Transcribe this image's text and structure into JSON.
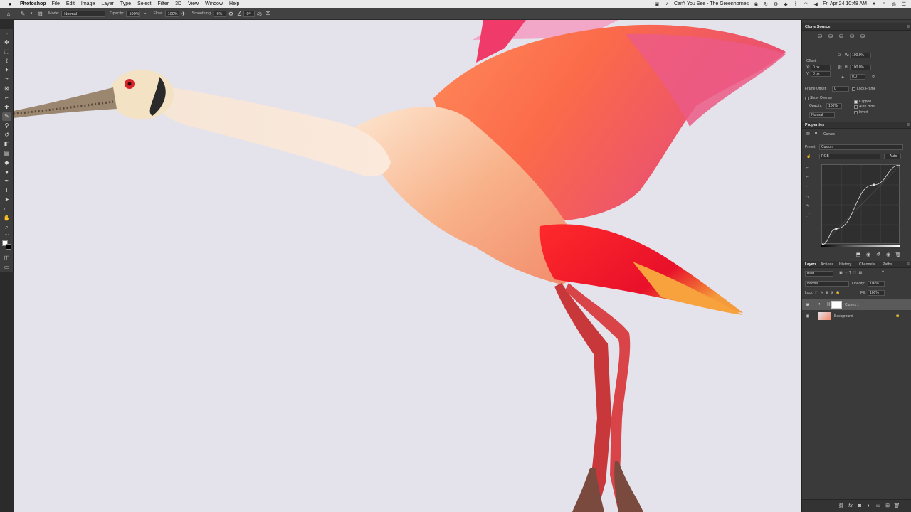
{
  "menubar": {
    "app": "Photoshop",
    "items": [
      "File",
      "Edit",
      "Image",
      "Layer",
      "Type",
      "Select",
      "Filter",
      "3D",
      "View",
      "Window",
      "Help"
    ],
    "now_playing": "Can't You See - The Greenhornes",
    "clock": "Fri Apr 24  10:48 AM"
  },
  "options": {
    "mode_label": "Mode:",
    "mode_value": "Normal",
    "opacity_label": "Opacity:",
    "opacity_value": "100%",
    "flow_label": "Flow:",
    "flow_value": "100%",
    "smoothing_label": "Smoothing:",
    "smoothing_value": "6%",
    "angle_value": "0°"
  },
  "clone_source": {
    "title": "Clone Source",
    "offset_label": "Offset:",
    "x_label": "X:",
    "x_value": "0 px",
    "y_label": "Y:",
    "y_value": "0 px",
    "w_label": "W:",
    "w_value": "100.0%",
    "h_label": "H:",
    "h_value": "100.0%",
    "angle_value": "0.0",
    "frame_offset_label": "Frame Offset:",
    "frame_offset_value": "0",
    "lock_frame_label": "Lock Frame",
    "show_overlay_label": "Show Overlay",
    "opacity_label": "Opacity:",
    "opacity_value": "100%",
    "clipped_label": "Clipped",
    "auto_hide_label": "Auto Hide",
    "invert_label": "Invert",
    "blend_value": "Normal"
  },
  "properties": {
    "title": "Properties",
    "adjustment_name": "Curves",
    "preset_label": "Preset:",
    "preset_value": "Custom",
    "channel_value": "RGB",
    "auto_label": "Auto",
    "curve_points": [
      [
        0,
        0
      ],
      [
        0.18,
        0.2
      ],
      [
        0.66,
        0.75
      ],
      [
        1,
        1
      ]
    ]
  },
  "layers_panel": {
    "tabs": [
      "Layers",
      "Actions",
      "History",
      "Channels",
      "Paths"
    ],
    "active_tab": "Layers",
    "kind_label": "Kind",
    "blend_value": "Normal",
    "opacity_label": "Opacity:",
    "opacity_value": "100%",
    "lock_label": "Lock:",
    "fill_label": "Fill:",
    "fill_value": "100%",
    "layers": [
      {
        "name": "Curves 1",
        "selected": true
      },
      {
        "name": "Background",
        "selected": false
      }
    ]
  },
  "colors": {
    "canvas_bg": "#e4e2ea",
    "panel_bg": "#3a3a3a",
    "foreground_swatch": "#ffffff",
    "background_swatch": "#000000"
  }
}
